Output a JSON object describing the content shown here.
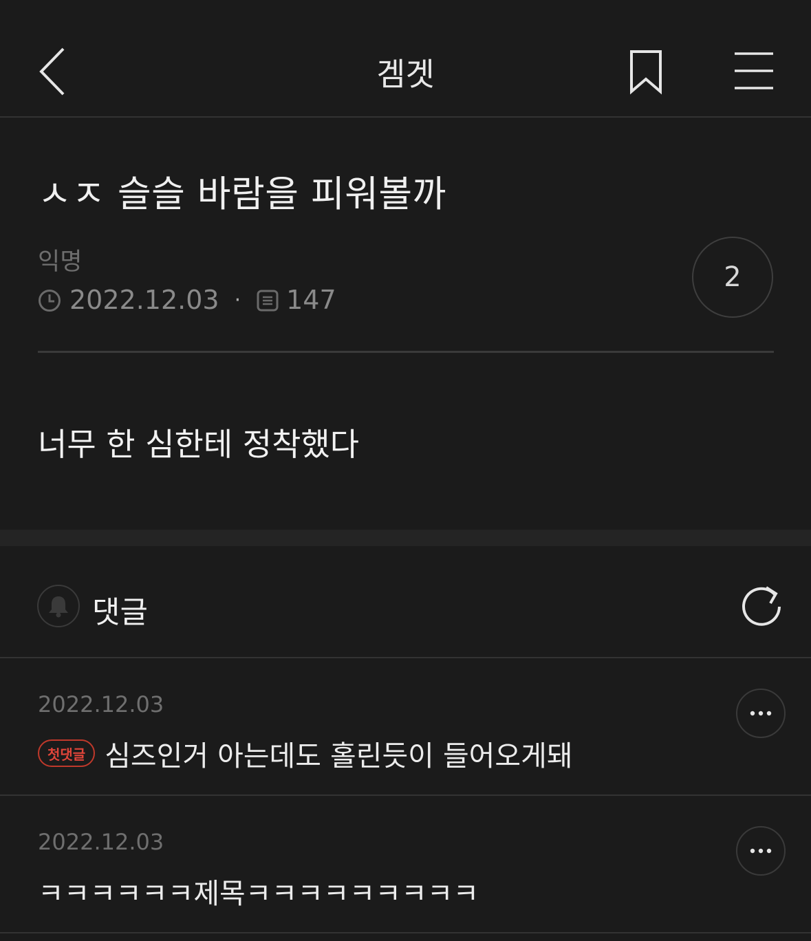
{
  "header": {
    "title": "겜겟",
    "back_icon": "chevron-left-icon",
    "bookmark_icon": "bookmark-icon",
    "menu_icon": "hamburger-menu-icon"
  },
  "post": {
    "title": "ㅅㅈ 슬슬 바람을 피워볼까",
    "author": "익명",
    "date": "2022.12.03",
    "separator": "·",
    "views": "147",
    "comment_count": "2",
    "body": "너무 한 심한테 정착했다"
  },
  "comments_section": {
    "label": "댓글",
    "bell_icon": "bell-icon",
    "refresh_icon": "refresh-icon"
  },
  "comments": [
    {
      "date": "2022.12.03",
      "badge": "첫댓글",
      "text": "심즈인거 아는데도 홀린듯이 들어오게돼"
    },
    {
      "date": "2022.12.03",
      "badge": "",
      "text": "ㅋㅋㅋㅋㅋㅋ제목ㅋㅋㅋㅋㅋㅋㅋㅋㅋ"
    }
  ],
  "colors": {
    "background": "#1b1b1b",
    "divider": "#333333",
    "badge_red": "#c0392b"
  }
}
